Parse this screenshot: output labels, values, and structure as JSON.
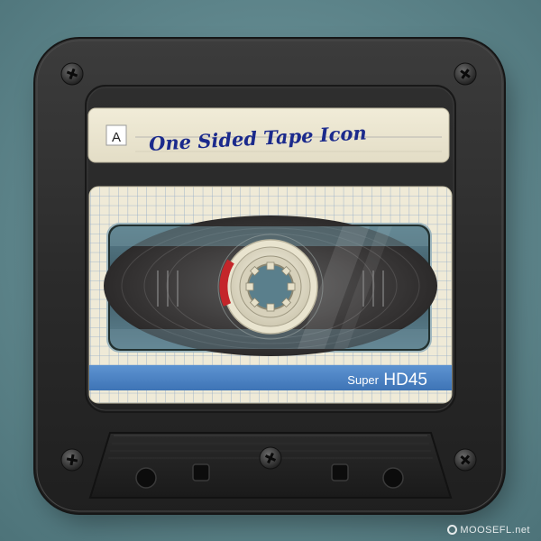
{
  "label": {
    "side": "A",
    "title": "One Sided Tape Icon"
  },
  "stripe": {
    "prefix": "Super",
    "model": "HD45"
  },
  "watermark": "MOOSEFL.net",
  "colors": {
    "background": "#6e9398",
    "shell": "#2a2a2a",
    "label_paper": "#ebe6d2",
    "handwriting": "#1b2a8c",
    "stripe": "#4a82c4",
    "grid_line": "#8fa9c8",
    "reel_ring": "#e9e4cf",
    "reel_marker": "#c4262a"
  },
  "icons": {
    "screws": "phillips-screw-icon",
    "reel": "tape-reel-icon"
  }
}
